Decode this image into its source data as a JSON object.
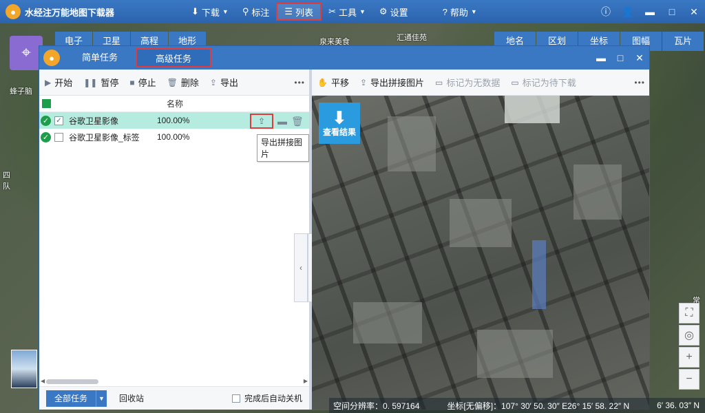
{
  "app": {
    "title": "水经注万能地图下载器",
    "menu": [
      "下载",
      "标注",
      "列表",
      "工具",
      "设置",
      "帮助"
    ],
    "active_menu": "列表"
  },
  "layer_tabs_left": [
    "电子",
    "卫星",
    "高程",
    "地形"
  ],
  "layer_tabs_right": [
    "地名",
    "区划",
    "坐标",
    "图幅",
    "瓦片"
  ],
  "map_labels": {
    "left": "蜂子脑",
    "top1": "泉来美食",
    "top2": "汇通佳苑",
    "left2": "四",
    "left3": "队",
    "right": "常"
  },
  "dialog": {
    "tabs": [
      "简单任务",
      "高级任务"
    ],
    "active_tab": "高级任务"
  },
  "left_toolbar": [
    "开始",
    "暂停",
    "停止",
    "删除",
    "导出"
  ],
  "list": {
    "header": "名称",
    "rows": [
      {
        "name": "谷歌卫星影像",
        "progress": "100.00%",
        "checked": true
      },
      {
        "name": "谷歌卫星影像_标签",
        "progress": "100.00%",
        "checked": false
      }
    ]
  },
  "tooltip": "导出拼接图片",
  "footer": {
    "all_tasks": "全部任务",
    "recycle": "回收站",
    "auto_shutdown": "完成后自动关机"
  },
  "right_toolbar": {
    "pan": "平移",
    "export_mosaic": "导出拼接图片",
    "mark_no_data": "标记为无数据",
    "mark_pending": "标记为待下载"
  },
  "view_result": "查看结果",
  "status": {
    "resolution": "空间分辨率：0. 597164",
    "coords": "坐标[无偏移]：107° 30′ 50. 30″ E26° 15′ 58. 22″ N",
    "extra": "6′ 36. 03″ N"
  },
  "colors": {
    "primary_blue": "#3a78c4",
    "highlight_red": "#e23b3b",
    "selected_row": "#b5ecdf",
    "ok_green": "#1c9e4a"
  }
}
